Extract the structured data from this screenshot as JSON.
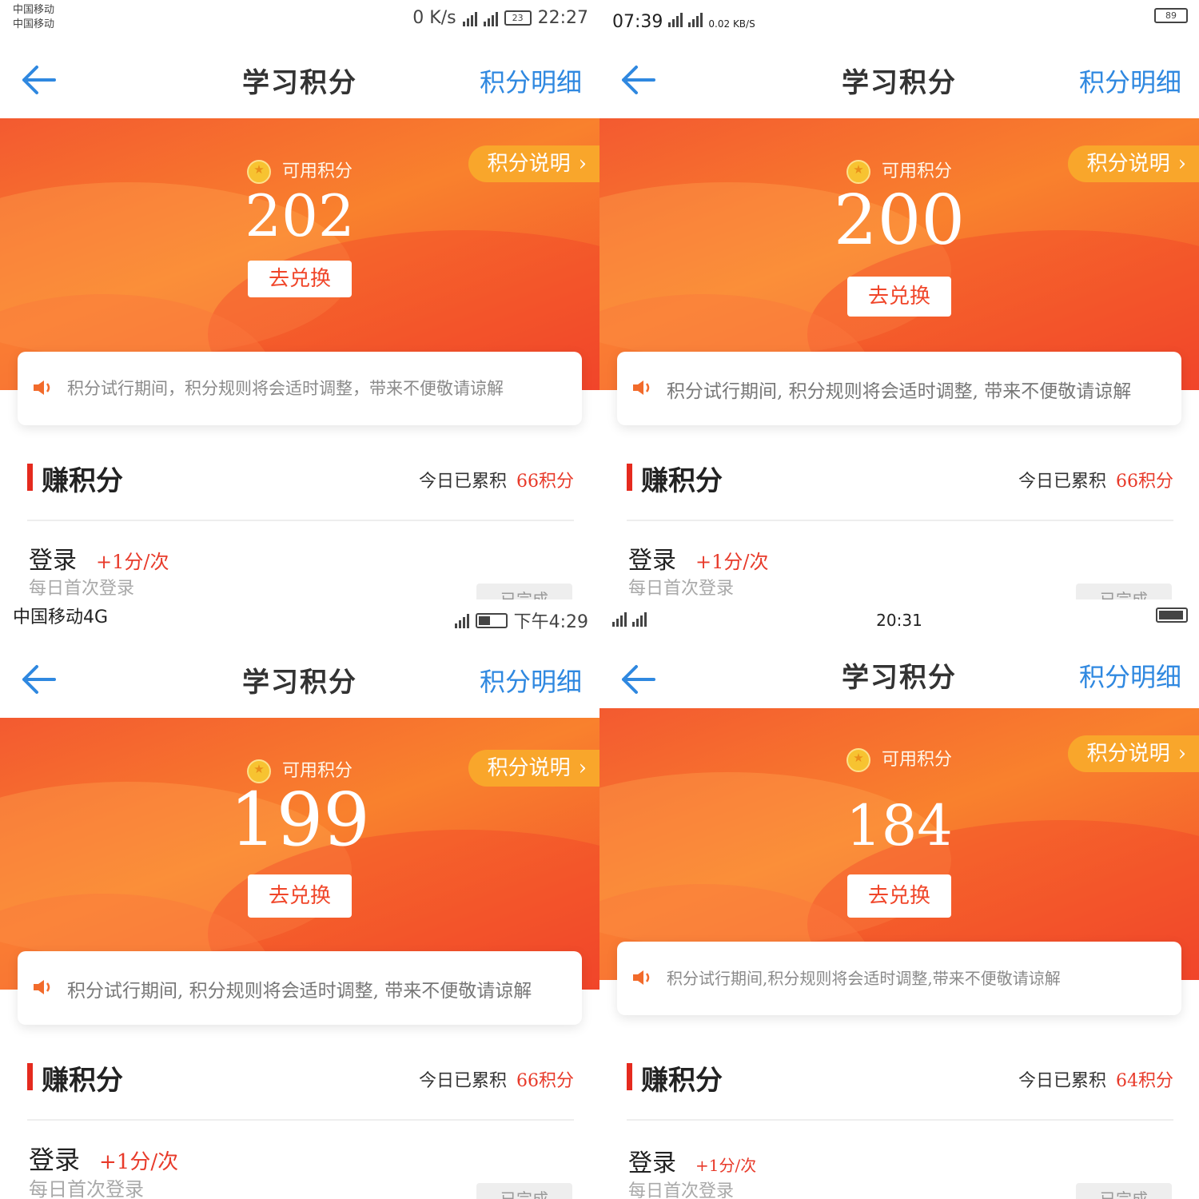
{
  "screens": [
    {
      "status": {
        "left_lines": [
          "中国移动",
          "中国移动"
        ],
        "center": "",
        "right": "0 K/s",
        "time": "22:27",
        "battery": "23"
      },
      "title": "学习积分",
      "detail_link": "积分明细",
      "available_label": "可用积分",
      "points": "202",
      "redeem": "去兑换",
      "explain": "积分说明",
      "explain_chevron": "›",
      "notice": "积分试行期间，积分规则将会适时调整，带来不便敬请谅解",
      "earn_title": "赚积分",
      "today_label": "今日已累积",
      "today_value": "66积分",
      "task_name": "登录",
      "task_bonus": "+1分/次",
      "task_desc": "每日首次登录",
      "task_button": "已完成"
    },
    {
      "status": {
        "left_lines": [
          "07:39"
        ],
        "center": "",
        "right": "0.02 KB/S",
        "time": "",
        "battery": "89"
      },
      "title": "学习积分",
      "detail_link": "积分明细",
      "available_label": "可用积分",
      "points": "200",
      "redeem": "去兑换",
      "explain": "积分说明",
      "explain_chevron": "›",
      "notice": "积分试行期间, 积分规则将会适时调整, 带来不便敬请谅解",
      "earn_title": "赚积分",
      "today_label": "今日已累积",
      "today_value": "66积分",
      "task_name": "登录",
      "task_bonus": "+1分/次",
      "task_desc": "每日首次登录",
      "task_button": "已完成"
    },
    {
      "status": {
        "left_lines": [
          "中国移动4G"
        ],
        "center": "",
        "right": "",
        "time": "下午4:29",
        "battery": ""
      },
      "title": "学习积分",
      "detail_link": "积分明细",
      "available_label": "可用积分",
      "points": "199",
      "redeem": "去兑换",
      "explain": "积分说明",
      "explain_chevron": "›",
      "notice": "积分试行期间, 积分规则将会适时调整, 带来不便敬请谅解",
      "earn_title": "赚积分",
      "today_label": "今日已累积",
      "today_value": "66积分",
      "task_name": "登录",
      "task_bonus": "+1分/次",
      "task_desc": "每日首次登录",
      "task_button": "已完成"
    },
    {
      "status": {
        "left_lines": [
          ""
        ],
        "center": "20:31",
        "right": "",
        "time": "",
        "battery": ""
      },
      "title": "学习积分",
      "detail_link": "积分明细",
      "available_label": "可用积分",
      "points": "184",
      "redeem": "去兑换",
      "explain": "积分说明",
      "explain_chevron": "›",
      "notice": "积分试行期间,积分规则将会适时调整,带来不便敬请谅解",
      "earn_title": "赚积分",
      "today_label": "今日已累积",
      "today_value": "64积分",
      "task_name": "登录",
      "task_bonus": "+1分/次",
      "task_desc": "每日首次登录",
      "task_button": "已完成"
    }
  ],
  "colors": {
    "accent_blue": "#2f88e0",
    "hero_orange": "#f35a30",
    "explain_badge": "#f9a62b",
    "earn_red": "#e83a2a"
  }
}
